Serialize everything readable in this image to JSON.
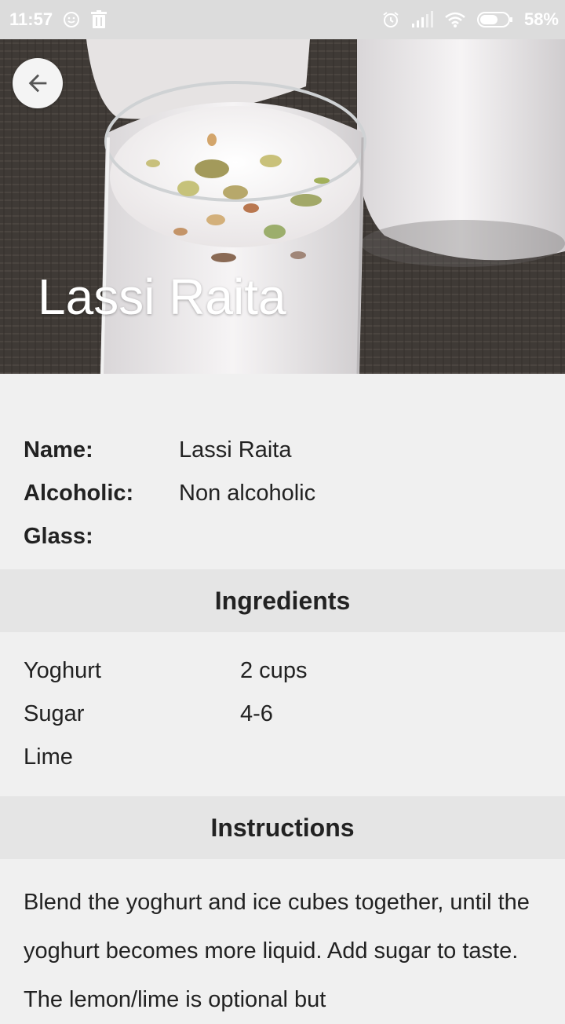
{
  "status_bar": {
    "time": "11:57",
    "battery": "58%"
  },
  "hero": {
    "title": "Lassi Raita"
  },
  "details": {
    "name_label": "Name:",
    "name_value": "Lassi Raita",
    "alcoholic_label": "Alcoholic:",
    "alcoholic_value": "Non alcoholic",
    "glass_label": "Glass:",
    "glass_value": ""
  },
  "ingredients": {
    "header": "Ingredients",
    "items": [
      {
        "name": "Yoghurt",
        "measure": "2 cups"
      },
      {
        "name": "Sugar",
        "measure": "4-6"
      },
      {
        "name": "Lime",
        "measure": ""
      }
    ]
  },
  "instructions": {
    "header": "Instructions",
    "text": "Blend the yoghurt and ice cubes together, until the yoghurt becomes more liquid. Add sugar to taste. The lemon/lime is optional but"
  },
  "colors": {
    "page_background": "#f0f0f0",
    "section_header_background": "#e5e5e5",
    "status_bar_background": "#dcdcdc"
  },
  "icons": {
    "back": "arrow-back-icon",
    "status": [
      "smiley-icon",
      "trash-icon",
      "alarm-icon",
      "signal-icon",
      "wifi-icon",
      "battery-icon"
    ]
  }
}
